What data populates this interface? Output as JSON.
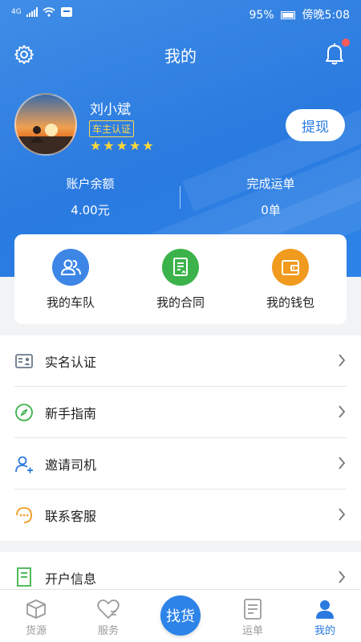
{
  "status_bar": {
    "network": "4G",
    "battery": "95%",
    "time": "傍晚5:08"
  },
  "header": {
    "title": "我的"
  },
  "profile": {
    "name": "刘小斌",
    "badge": "车主认证",
    "rating": 5,
    "withdraw_label": "提现"
  },
  "stats": {
    "balance_label": "账户余额",
    "balance_value": "4.00元",
    "orders_label": "完成运单",
    "orders_value": "0单"
  },
  "quick_actions": [
    {
      "label": "我的车队",
      "icon": "team-icon",
      "color": "#3d86e6"
    },
    {
      "label": "我的合同",
      "icon": "contract-icon",
      "color": "#3cb34a"
    },
    {
      "label": "我的钱包",
      "icon": "wallet-icon",
      "color": "#f09a1e"
    }
  ],
  "menu": [
    {
      "label": "实名认证",
      "icon": "id-card-icon"
    },
    {
      "label": "新手指南",
      "icon": "compass-icon"
    },
    {
      "label": "邀请司机",
      "icon": "invite-user-icon"
    },
    {
      "label": "联系客服",
      "icon": "customer-service-icon"
    }
  ],
  "menu2": [
    {
      "label": "开户信息",
      "icon": "account-info-icon"
    }
  ],
  "tabs": [
    {
      "label": "货源",
      "icon": "box-icon"
    },
    {
      "label": "服务",
      "icon": "heart-icon"
    },
    {
      "label": "找货",
      "icon": "center-button"
    },
    {
      "label": "运单",
      "icon": "waybill-icon"
    },
    {
      "label": "我的",
      "icon": "user-icon"
    }
  ],
  "colors": {
    "primary": "#2a7ae0",
    "star": "#ffd83a",
    "badge_dot": "#ff5a5a"
  }
}
